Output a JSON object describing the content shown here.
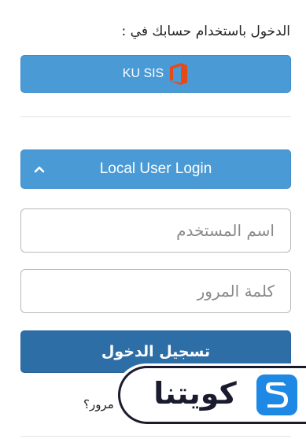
{
  "login": {
    "heading": "الدخول باستخدام حسابك في :",
    "sso_button_label": "KU SIS",
    "local_toggle_label": "Local User Login",
    "username_placeholder": "اسم المستخدم",
    "password_placeholder": "كلمة المرور",
    "submit_label": "تسجيل الدخول",
    "forgot_label": "مرور؟"
  },
  "watermark": {
    "text": "كويتنا"
  },
  "icons": {
    "sso": "office-icon",
    "toggle": "chevron-up-icon",
    "watermark_logo": "lightning-s-icon"
  },
  "colors": {
    "sso_button": "#4a9ad6",
    "toggle_button": "#4a9ad6",
    "submit_button": "#2e6ea6",
    "office_orange": "#e64a19",
    "watermark_dark": "#1b1b2f",
    "watermark_blue": "#1e88e5"
  }
}
